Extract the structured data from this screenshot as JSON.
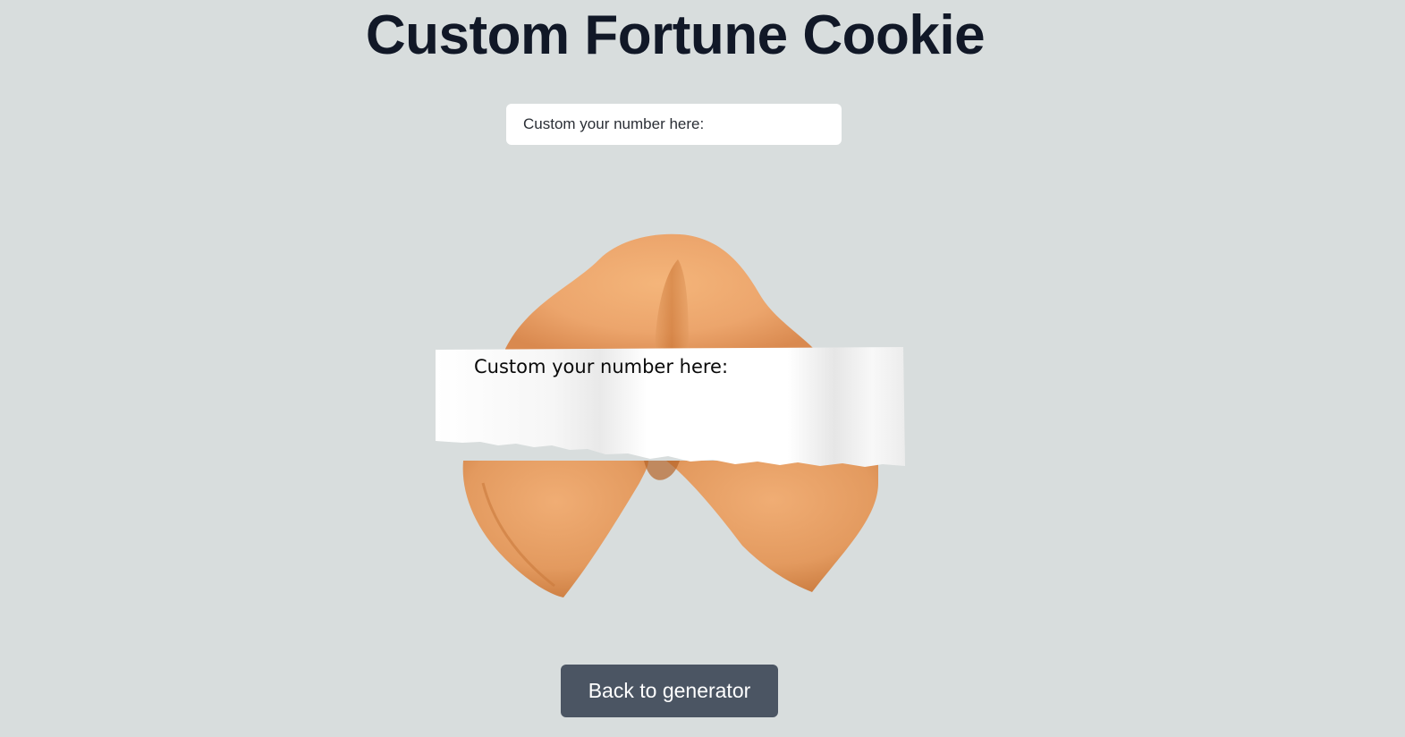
{
  "page": {
    "title": "Custom Fortune Cookie"
  },
  "input": {
    "placeholder": "Custom your number here:",
    "value": ""
  },
  "fortune": {
    "text": "Custom your number here:"
  },
  "back_button": {
    "label": "Back to generator"
  },
  "colors": {
    "background": "#d8dddd",
    "title": "#111827",
    "button": "#4b5563",
    "cookie": "#e9a46c"
  }
}
